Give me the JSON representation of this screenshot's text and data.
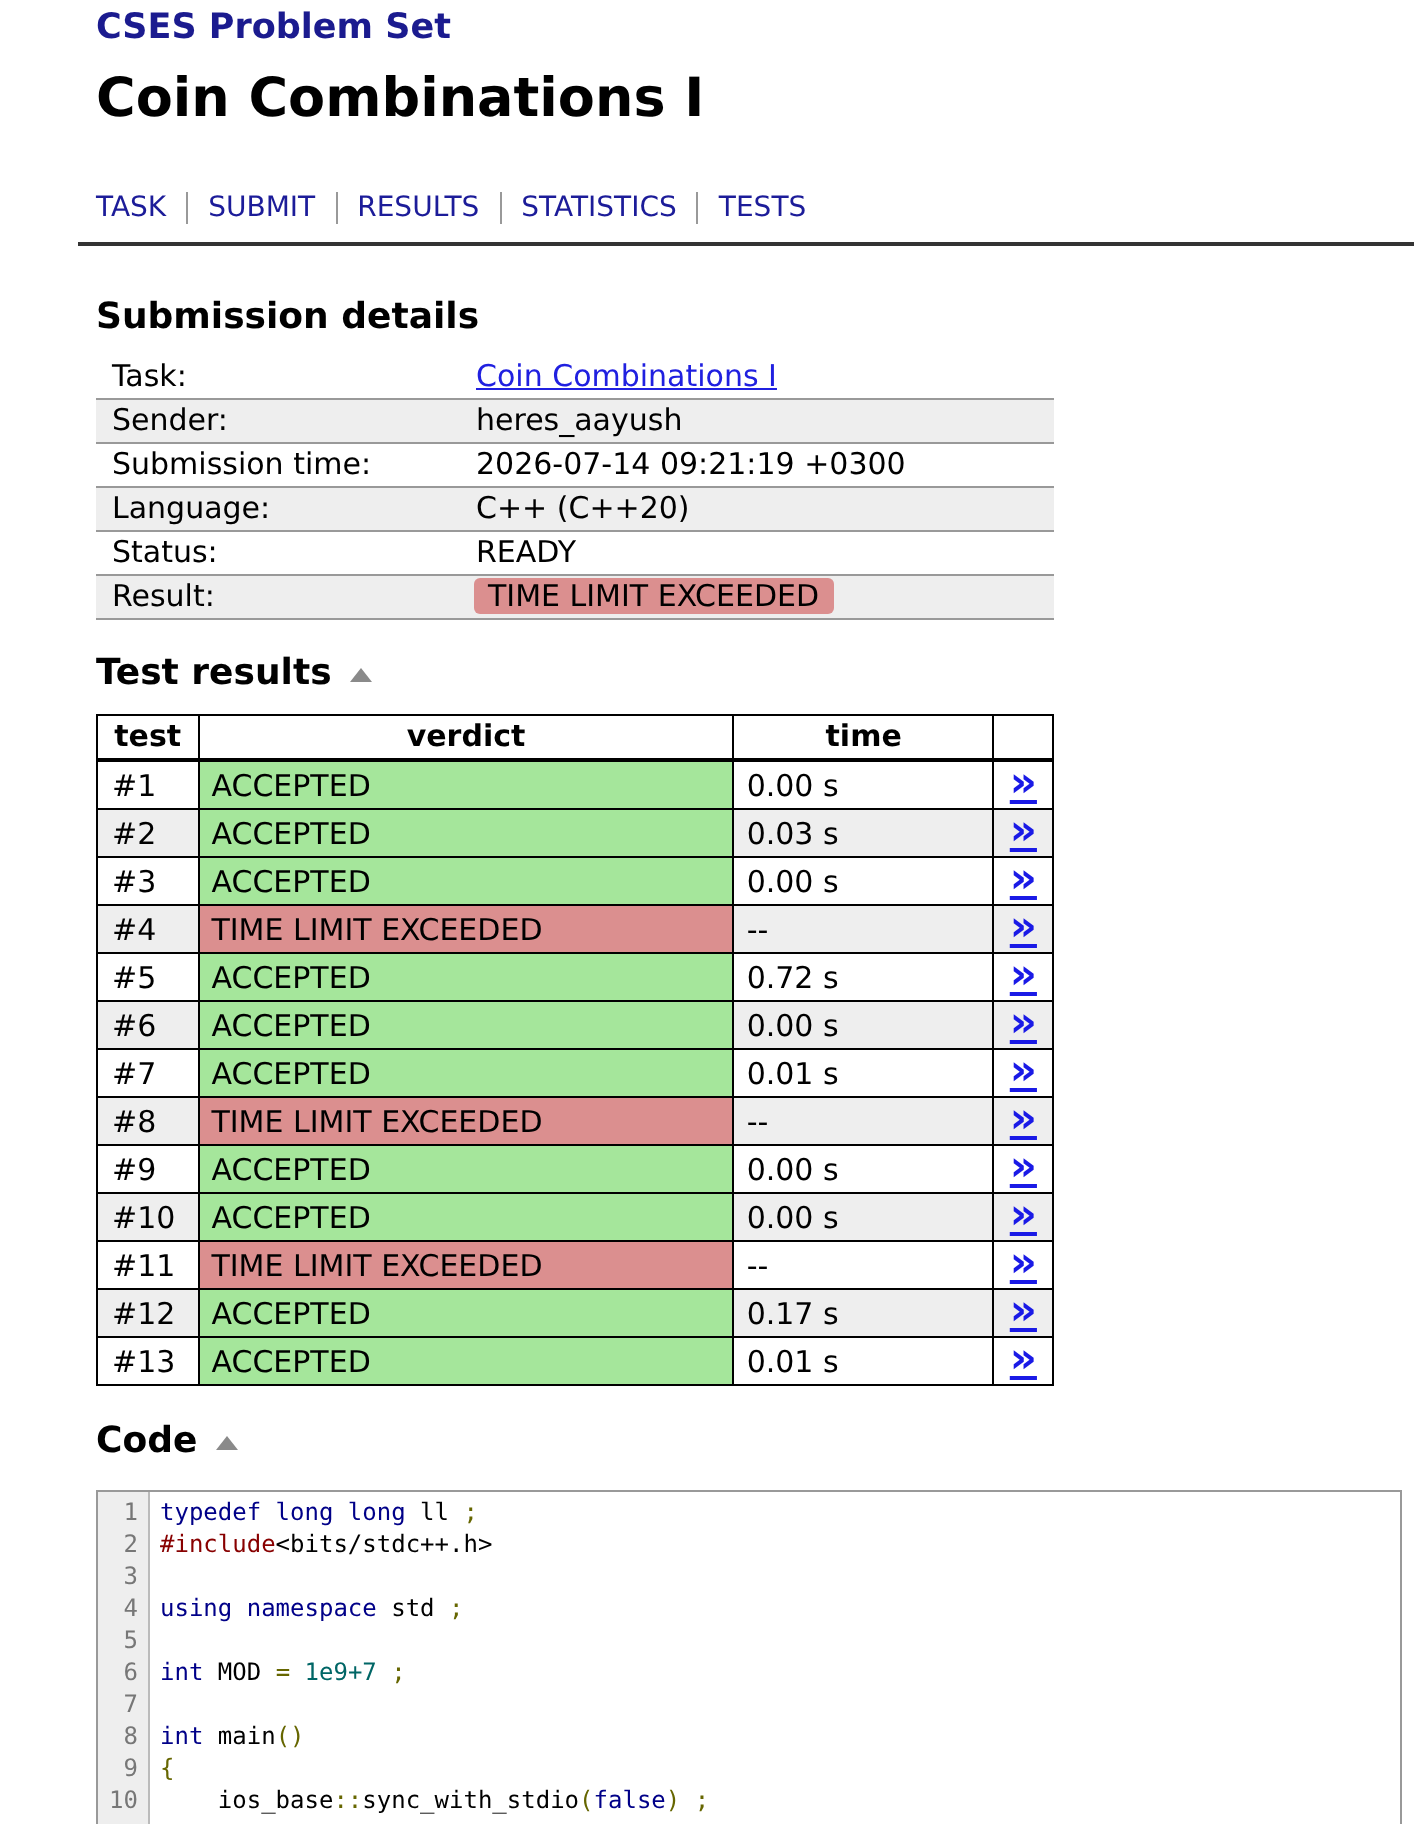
{
  "site": {
    "title": "CSES Problem Set"
  },
  "page_title": "Coin Combinations I",
  "nav": [
    "TASK",
    "SUBMIT",
    "RESULTS",
    "STATISTICS",
    "TESTS"
  ],
  "submission": {
    "heading": "Submission details",
    "rows": [
      {
        "label": "Task:",
        "value": "Coin Combinations I",
        "kind": "link"
      },
      {
        "label": "Sender:",
        "value": "heres_aayush",
        "kind": "text"
      },
      {
        "label": "Submission time:",
        "value": "2026-07-14 09:21:19 +0300",
        "kind": "text"
      },
      {
        "label": "Language:",
        "value": "C++ (C++20)",
        "kind": "text"
      },
      {
        "label": "Status:",
        "value": "READY",
        "kind": "text"
      },
      {
        "label": "Result:",
        "value": "TIME LIMIT EXCEEDED",
        "kind": "badge",
        "color": "#db8f8f"
      }
    ]
  },
  "test_results": {
    "heading": "Test results",
    "expanded": true,
    "columns": [
      "test",
      "verdict",
      "time"
    ],
    "rows": [
      {
        "test": "#1",
        "verdict": "ACCEPTED",
        "color": "#a5e69b",
        "time": "0.00 s",
        "link": "»"
      },
      {
        "test": "#2",
        "verdict": "ACCEPTED",
        "color": "#a5e69b",
        "time": "0.03 s",
        "link": "»"
      },
      {
        "test": "#3",
        "verdict": "ACCEPTED",
        "color": "#a5e69b",
        "time": "0.00 s",
        "link": "»"
      },
      {
        "test": "#4",
        "verdict": "TIME LIMIT EXCEEDED",
        "color": "#db8f8f",
        "time": "--",
        "link": "»"
      },
      {
        "test": "#5",
        "verdict": "ACCEPTED",
        "color": "#a5e69b",
        "time": "0.72 s",
        "link": "»"
      },
      {
        "test": "#6",
        "verdict": "ACCEPTED",
        "color": "#a5e69b",
        "time": "0.00 s",
        "link": "»"
      },
      {
        "test": "#7",
        "verdict": "ACCEPTED",
        "color": "#a5e69b",
        "time": "0.01 s",
        "link": "»"
      },
      {
        "test": "#8",
        "verdict": "TIME LIMIT EXCEEDED",
        "color": "#db8f8f",
        "time": "--",
        "link": "»"
      },
      {
        "test": "#9",
        "verdict": "ACCEPTED",
        "color": "#a5e69b",
        "time": "0.00 s",
        "link": "»"
      },
      {
        "test": "#10",
        "verdict": "ACCEPTED",
        "color": "#a5e69b",
        "time": "0.00 s",
        "link": "»"
      },
      {
        "test": "#11",
        "verdict": "TIME LIMIT EXCEEDED",
        "color": "#db8f8f",
        "time": "--",
        "link": "»"
      },
      {
        "test": "#12",
        "verdict": "ACCEPTED",
        "color": "#a5e69b",
        "time": "0.17 s",
        "link": "»"
      },
      {
        "test": "#13",
        "verdict": "ACCEPTED",
        "color": "#a5e69b",
        "time": "0.01 s",
        "link": "»"
      }
    ]
  },
  "code": {
    "heading": "Code",
    "expanded": true,
    "lines": [
      {
        "number": "1",
        "tokens": [
          {
            "kind": "kwd",
            "text": "typedef"
          },
          {
            "kind": "kwd",
            "text": " long"
          },
          {
            "kind": "kwd",
            "text": " long"
          },
          {
            "kind": "pln",
            "text": " ll "
          },
          {
            "kind": "pun",
            "text": ";"
          }
        ]
      },
      {
        "number": "2",
        "tokens": [
          {
            "kind": "com",
            "text": "#include"
          },
          {
            "kind": "pln",
            "text": "<bits/stdc++.h>"
          }
        ]
      },
      {
        "number": "3"
      },
      {
        "number": "4",
        "tokens": [
          {
            "kind": "kwd",
            "text": "using"
          },
          {
            "kind": "kwd",
            "text": " namespace"
          },
          {
            "kind": "pln",
            "text": " std "
          },
          {
            "kind": "pun",
            "text": ";"
          }
        ]
      },
      {
        "number": "5"
      },
      {
        "number": "6",
        "tokens": [
          {
            "kind": "kwd",
            "text": "int"
          },
          {
            "kind": "pln",
            "text": " MOD "
          },
          {
            "kind": "pun",
            "text": "="
          },
          {
            "kind": "lit",
            "text": " 1e9+7"
          },
          {
            "kind": "pun",
            "text": " ;"
          }
        ]
      },
      {
        "number": "7"
      },
      {
        "number": "8",
        "tokens": [
          {
            "kind": "kwd",
            "text": "int"
          },
          {
            "kind": "pln",
            "text": " main"
          },
          {
            "kind": "pun",
            "text": "()"
          }
        ]
      },
      {
        "number": "9",
        "tokens": [
          {
            "kind": "pun",
            "text": "{"
          }
        ]
      },
      {
        "number": "10",
        "tokens": [
          {
            "kind": "pln",
            "text": "    ios_base"
          },
          {
            "kind": "pun",
            "text": "::"
          },
          {
            "kind": "pln",
            "text": "sync_with_stdio"
          },
          {
            "kind": "pun",
            "text": "("
          },
          {
            "kind": "kwd",
            "text": "false"
          },
          {
            "kind": "pun",
            "text": ") ;"
          }
        ]
      }
    ]
  }
}
